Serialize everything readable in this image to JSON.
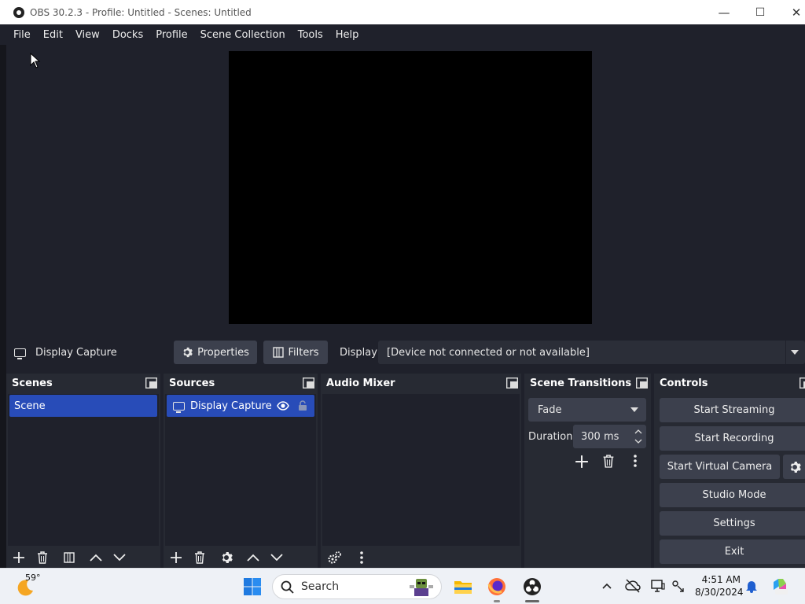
{
  "window": {
    "title": "OBS 30.2.3 - Profile: Untitled - Scenes: Untitled",
    "controls": {
      "minimize": "—",
      "maximize": "☐",
      "close": "✕"
    }
  },
  "menu": [
    "File",
    "Edit",
    "View",
    "Docks",
    "Profile",
    "Scene Collection",
    "Tools",
    "Help"
  ],
  "source_toolbar": {
    "source_name": "Display Capture",
    "properties_label": "Properties",
    "filters_label": "Filters",
    "display_label": "Display",
    "display_value": "[Device not connected or not available]"
  },
  "docks": {
    "scenes": {
      "title": "Scenes",
      "items": [
        "Scene"
      ]
    },
    "sources": {
      "title": "Sources",
      "items": [
        "Display Capture"
      ]
    },
    "audio_mixer": {
      "title": "Audio Mixer"
    },
    "transitions": {
      "title": "Scene Transitions",
      "selected": "Fade",
      "duration_label": "Duration",
      "duration_value": "300 ms"
    },
    "controls": {
      "title": "Controls",
      "start_streaming": "Start Streaming",
      "start_recording": "Start Recording",
      "start_virtual_camera": "Start Virtual Camera",
      "studio_mode": "Studio Mode",
      "settings": "Settings",
      "exit": "Exit"
    }
  },
  "taskbar": {
    "weather_temp": "59°",
    "search_placeholder": "Search",
    "time": "4:51 AM",
    "date": "8/30/2024"
  },
  "colors": {
    "accent": "#284cb8",
    "panel": "#272a33",
    "background": "#1f212b",
    "button": "#3c404d"
  }
}
